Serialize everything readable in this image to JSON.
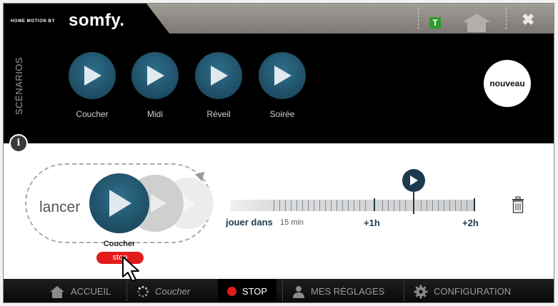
{
  "header": {
    "brand_small": "HOME MOTION BY",
    "brand_logo": "somfy.",
    "badge_letter": "T",
    "icons": [
      "home-icon",
      "close-icon"
    ],
    "close_symbol": "✖"
  },
  "scenarios": {
    "label": "SCÉNARIOS",
    "items": [
      {
        "name": "Coucher"
      },
      {
        "name": "Midi"
      },
      {
        "name": "Réveil"
      },
      {
        "name": "Soirée"
      }
    ],
    "new_label": "nouveau",
    "info_symbol": "i"
  },
  "launch": {
    "lancer_label": "lancer",
    "current_scenario": "Coucher",
    "stop_label": "stop"
  },
  "timeline": {
    "jouer_label": "jouer dans",
    "delay_label": "15 min",
    "mark_1h": "+1h",
    "mark_2h": "+2h"
  },
  "bottom_nav": {
    "accueil": "ACCUEIL",
    "running": "Coucher",
    "stop": "STOP",
    "reglages": "MES RÉGLAGES",
    "configuration": "CONFIGURATION"
  },
  "colors": {
    "play_blue": "#1c3a4f",
    "stop_red": "#e41b1b",
    "badge_green": "#2c9a2c"
  }
}
